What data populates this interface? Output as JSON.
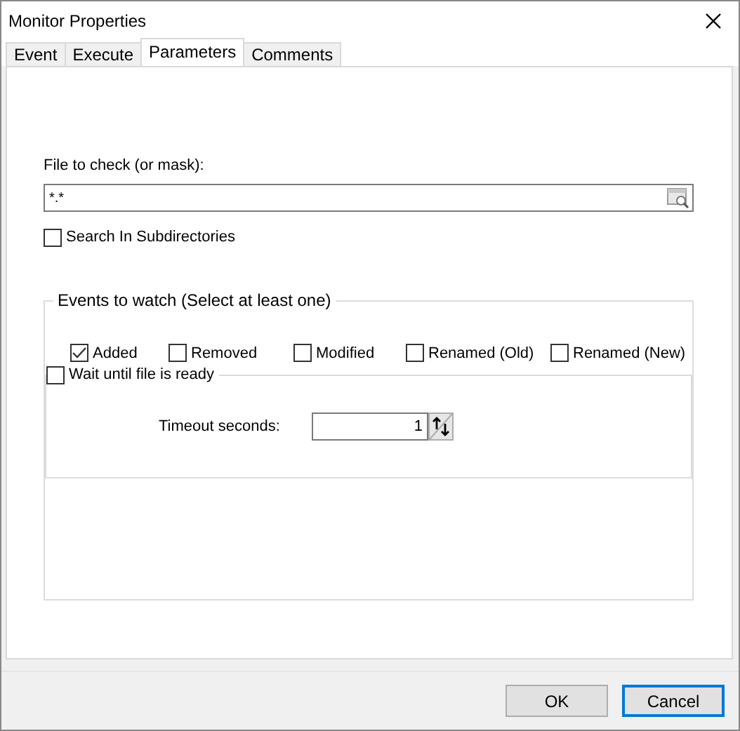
{
  "window": {
    "title": "Monitor Properties"
  },
  "tabs": [
    {
      "label": "Event",
      "selected": false
    },
    {
      "label": "Execute",
      "selected": false
    },
    {
      "label": "Parameters",
      "selected": true
    },
    {
      "label": "Comments",
      "selected": false
    }
  ],
  "file_field": {
    "label": "File to check (or mask):",
    "value": "*.*"
  },
  "subdirectories": {
    "label": "Search In Subdirectories",
    "checked": false
  },
  "events_group": {
    "title": "Events to watch (Select at least one)",
    "events": [
      {
        "label": "Added",
        "checked": true
      },
      {
        "label": "Removed",
        "checked": false
      },
      {
        "label": "Modified",
        "checked": false
      },
      {
        "label": "Renamed (Old)",
        "checked": false
      },
      {
        "label": "Renamed (New)",
        "checked": false
      }
    ]
  },
  "wait_group": {
    "label": "Wait until file is ready",
    "checked": false,
    "timeout_label": "Timeout seconds:",
    "timeout_value": "1"
  },
  "buttons": [
    {
      "label": "OK",
      "focused": false
    },
    {
      "label": "Cancel",
      "focused": true
    }
  ]
}
